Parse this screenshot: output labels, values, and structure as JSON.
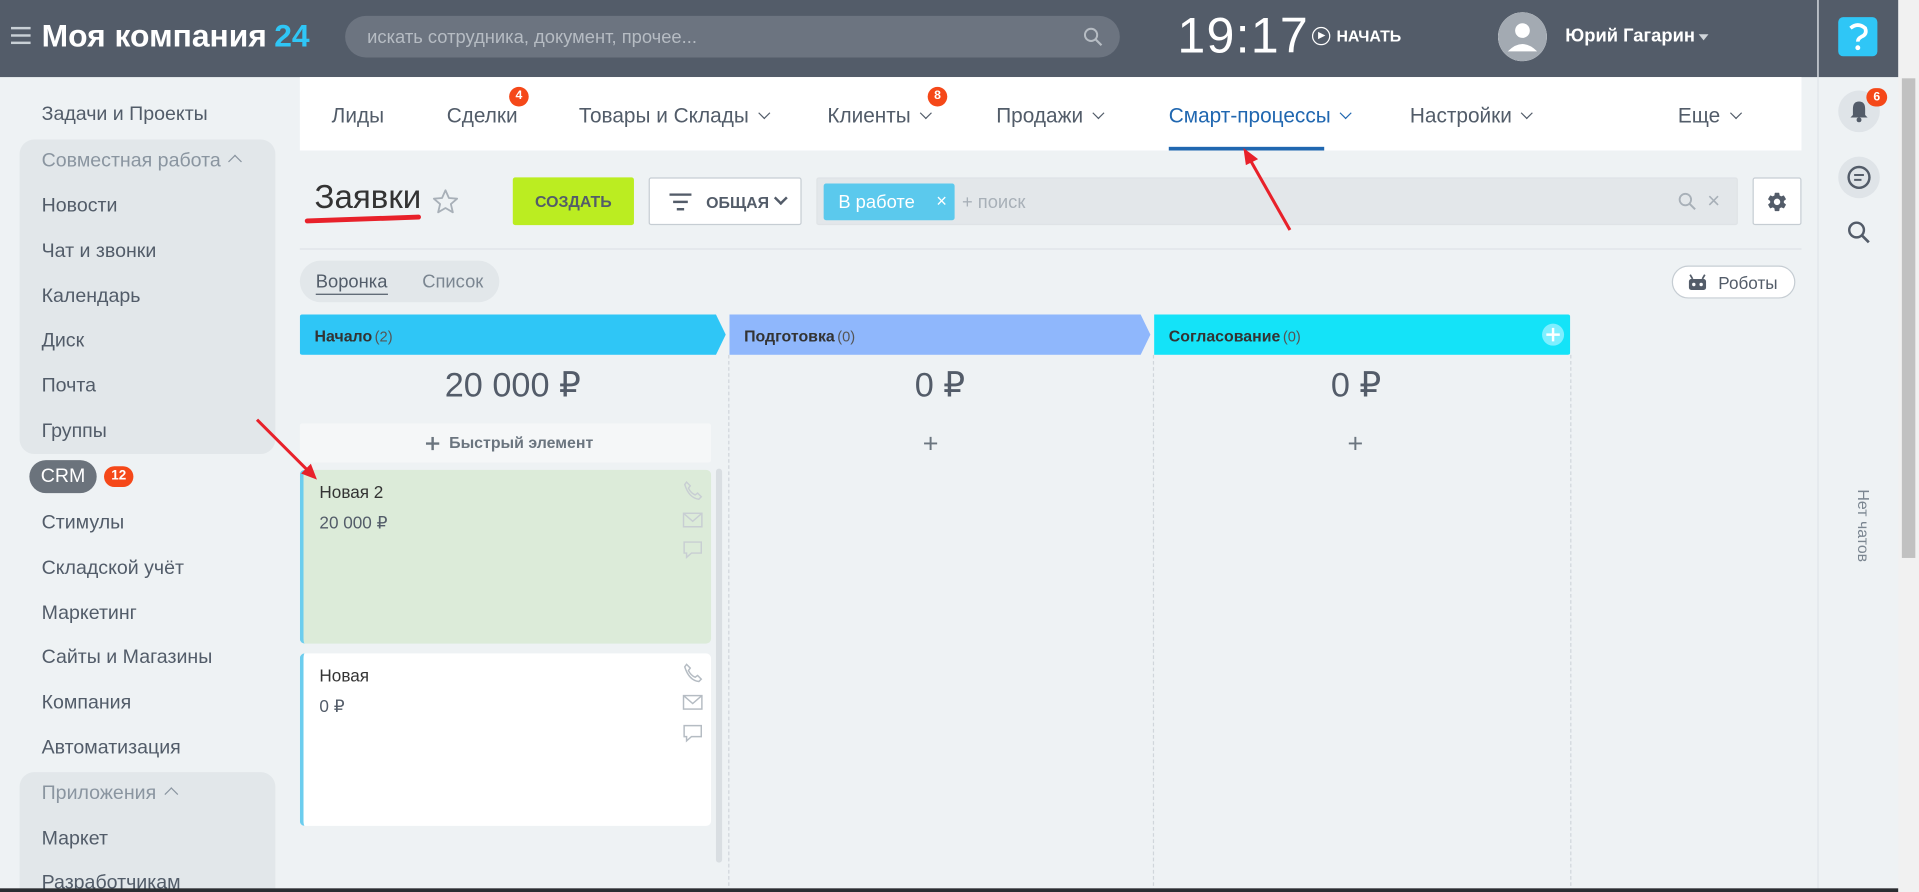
{
  "header": {
    "brand_name": "Моя компания",
    "brand_num": "24",
    "search_placeholder": "искать сотрудника, документ, прочее...",
    "clock": "19:17",
    "start_label": "НАЧАТЬ",
    "user_name": "Юрий Гагарин"
  },
  "left_menu": {
    "tasks": "Задачи и Проекты",
    "collab_group": "Совместная работа",
    "news": "Новости",
    "chat": "Чат и звонки",
    "calendar": "Календарь",
    "disk": "Диск",
    "mail": "Почта",
    "groups": "Группы",
    "crm": "CRM",
    "crm_badge": "12",
    "stimuli": "Стимулы",
    "warehouse": "Складской учёт",
    "marketing": "Маркетинг",
    "sites": "Сайты и Магазины",
    "company": "Компания",
    "automation": "Автоматизация",
    "apps_group": "Приложения",
    "market": "Маркет",
    "developers": "Разработчикам"
  },
  "tabs": {
    "leads": "Лиды",
    "deals": "Сделки",
    "deals_badge": "4",
    "goods": "Товары и Склады",
    "clients": "Клиенты",
    "clients_badge": "8",
    "sales": "Продажи",
    "smart": "Смарт-процессы",
    "settings": "Настройки",
    "more": "Еще"
  },
  "toolbar": {
    "page_title": "Заявки",
    "create_label": "СОЗДАТЬ",
    "filter_label": "ОБЩАЯ",
    "chip_label": "В работе",
    "chip_close": "×",
    "search_placeholder": "+ поиск",
    "clear": "×"
  },
  "view": {
    "funnel": "Воронка",
    "list": "Список",
    "robots": "Роботы"
  },
  "kanban": {
    "columns": [
      {
        "title": "Начало",
        "count": "(2)",
        "sum": "20 000 ₽",
        "color": "#2fc6f6"
      },
      {
        "title": "Подготовка",
        "count": "(0)",
        "sum": "0 ₽",
        "color": "#8fb7fc"
      },
      {
        "title": "Согласование",
        "count": "(0)",
        "sum": "0 ₽",
        "color": "#14e3f8"
      }
    ],
    "quick_add": "Быстрый элемент",
    "plus": "+",
    "cards": [
      {
        "title": "Новая 2",
        "sum": "20 000 ₽",
        "bg": "#dcebd9"
      },
      {
        "title": "Новая",
        "sum": "0 ₽",
        "bg": "#ffffff"
      }
    ]
  },
  "right_bar": {
    "help": "?",
    "notif_badge": "6",
    "no_chats": "Нет чатов"
  },
  "colors": {
    "header_bg": "#535c69",
    "accent_blue": "#2fc6f6",
    "create_green": "#bbed21",
    "badge_red": "#f54819",
    "active_tab": "#2067b0",
    "annotation_red": "#e8212a"
  }
}
